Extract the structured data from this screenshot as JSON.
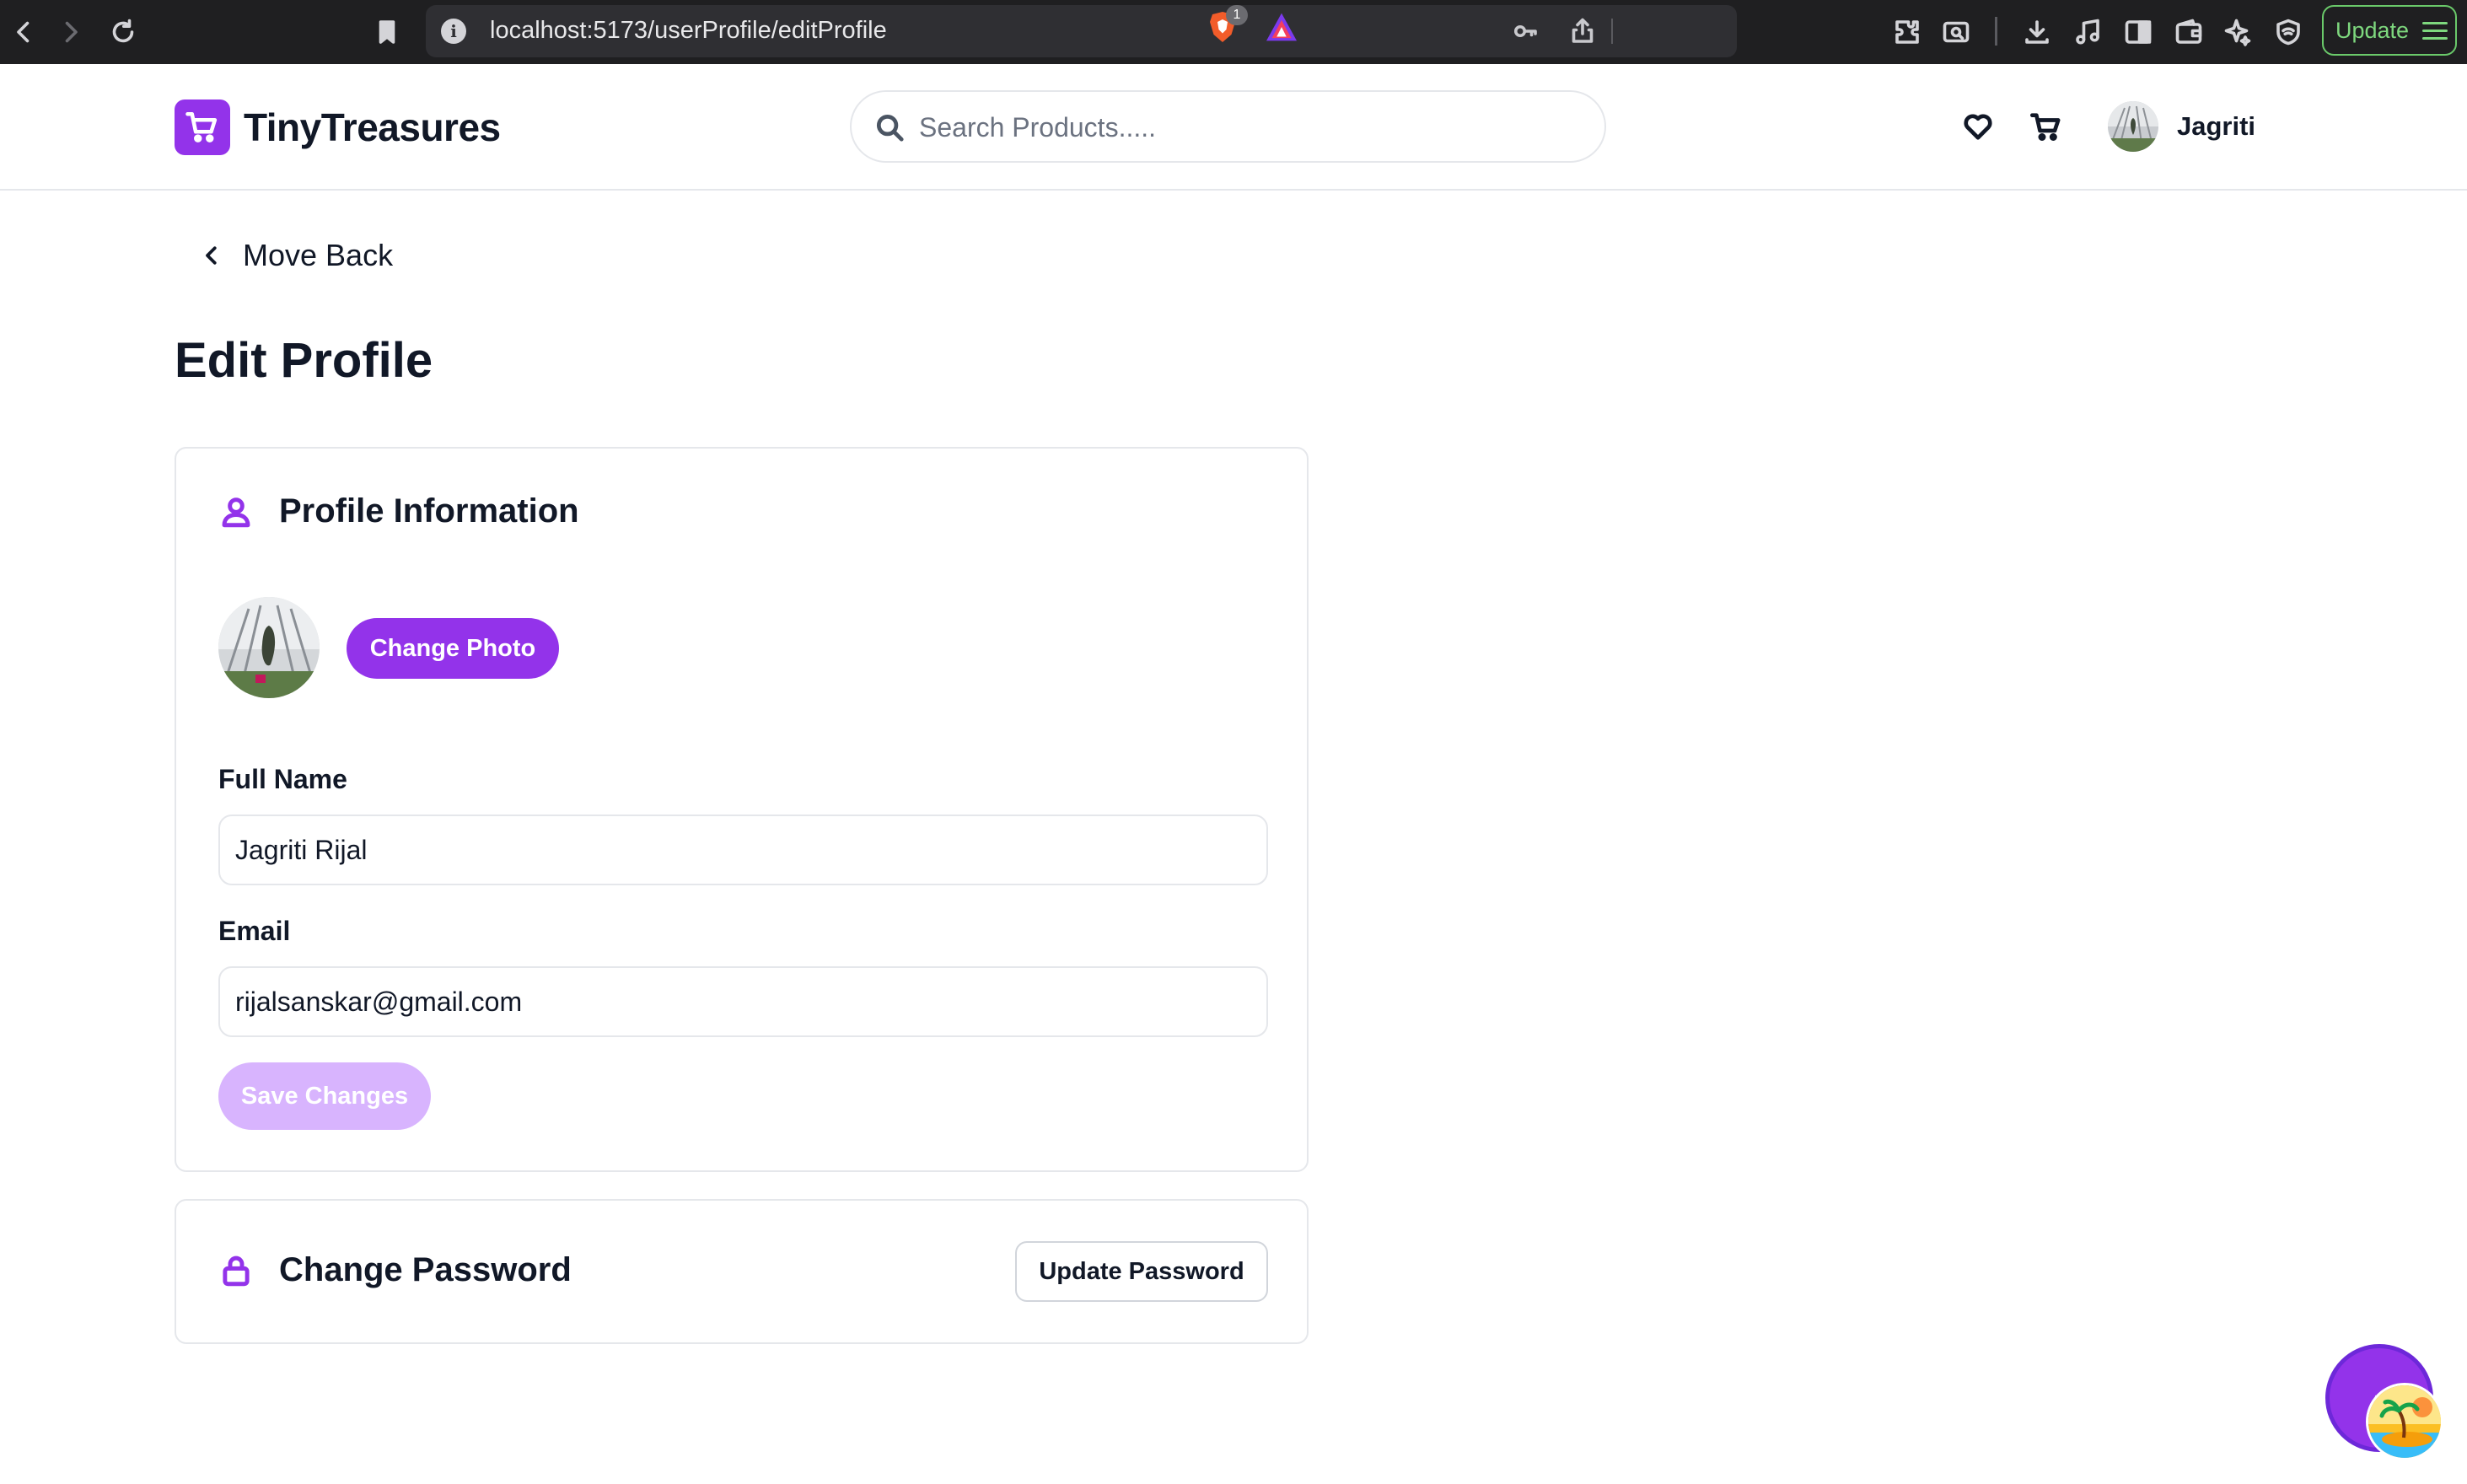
{
  "browser": {
    "url": "localhost:5173/userProfile/editProfile",
    "shields_count": "1",
    "update_label": "Update"
  },
  "header": {
    "brand": "TinyTreasures",
    "search_placeholder": "Search Products.....",
    "user_name": "Jagriti"
  },
  "page": {
    "back_label": "Move Back",
    "title": "Edit Profile"
  },
  "profile_section": {
    "title": "Profile Information",
    "change_photo_label": "Change Photo",
    "full_name_label": "Full Name",
    "full_name_value": "Jagriti Rijal",
    "email_label": "Email",
    "email_value": "rijalsanskar@gmail.com",
    "save_label": "Save Changes"
  },
  "password_section": {
    "title": "Change Password",
    "update_label": "Update Password"
  },
  "colors": {
    "accent": "#9333ea",
    "accent_disabled": "#d8b4fe",
    "border": "#e5e7eb",
    "text": "#111827",
    "chrome_bg": "#1f1f21",
    "update_green": "#7ed87e"
  },
  "icons": {
    "logo": "shopping-cart-icon",
    "search": "search-icon",
    "wishlist": "heart-icon",
    "cart": "cart-icon",
    "profile_section": "user-icon",
    "password_section": "lock-icon",
    "back": "chevron-left-icon",
    "chat": "chat-icon"
  }
}
